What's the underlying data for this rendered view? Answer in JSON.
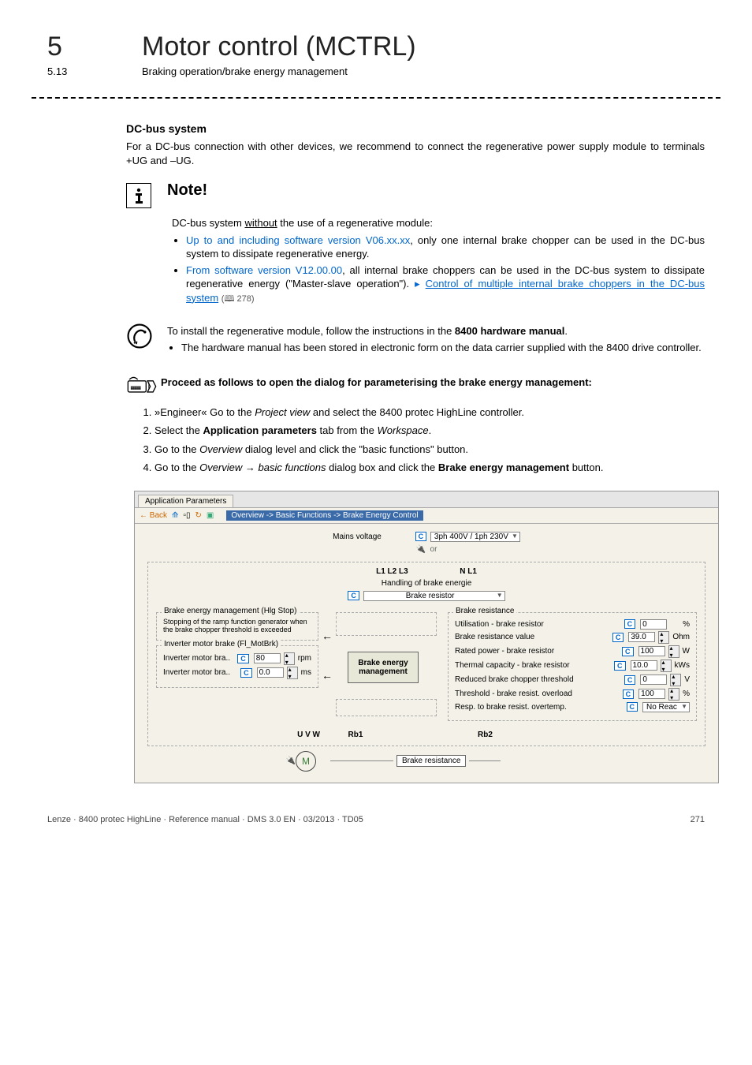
{
  "header": {
    "chapter_num": "5",
    "chapter_title": "Motor control (MCTRL)",
    "section_num": "5.13",
    "section_title": "Braking operation/brake energy management"
  },
  "dcbus": {
    "heading": "DC-bus system",
    "para": "For a DC-bus connection with other devices, we recommend to connect the regenerative power supply module to terminals +UG and –UG."
  },
  "note": {
    "title": "Note!",
    "intro_a": "DC-bus system ",
    "intro_underline": "without",
    "intro_b": " the use of a regenerative module:",
    "b1_blue": "Up to and including software version V06.xx.xx",
    "b1_rest": ", only one internal brake chopper can be used in the DC-bus system to dissipate regenerative energy.",
    "b2_blue": "From software version V12.00.00",
    "b2_rest_a": ", all internal brake choppers can be used in the DC-bus system to dissipate regenerative energy (\"Master-slave operation\").  ",
    "b2_link": "Control of multiple internal brake choppers in the DC-bus system",
    "b2_page": " 278)"
  },
  "tip": {
    "line1_a": "To install the regenerative module, follow the instructions in the ",
    "line1_b": "8400 hardware manual",
    "line1_c": ".",
    "bullet": "The hardware manual has been stored in electronic form on the data carrier supplied with the 8400 drive controller."
  },
  "proc": {
    "heading": "Proceed as follows to open the dialog for parameterising the brake energy management:",
    "s1_a": "»Engineer« Go to the ",
    "s1_i": "Project view",
    "s1_b": " and select the 8400 protec HighLine controller.",
    "s2_a": "Select the ",
    "s2_b": "Application parameters",
    "s2_c": " tab from the ",
    "s2_i": "Workspace",
    "s2_d": ".",
    "s3_a": "Go to the ",
    "s3_i": "Overview",
    "s3_b": " dialog level and click the \"basic functions\" button.",
    "s4_a": "Go to the ",
    "s4_i1": "Overview",
    "s4_arr": " → ",
    "s4_i2": "basic functions",
    "s4_b": " dialog box and click the ",
    "s4_bold": "Brake energy management",
    "s4_c": " button."
  },
  "ui": {
    "tab": "Application Parameters",
    "back": "← Back",
    "breadcrumb": "Overview -> Basic Functions -> Brake Energy Control",
    "mains_label": "Mains voltage",
    "mains_value": "3ph 400V / 1ph 230V",
    "or": "or",
    "l_labels": "L1  L2  L3",
    "n_label": "N  L1",
    "handling": "Handling of brake energie",
    "handling_value": "Brake resistor",
    "center": "Brake energy management",
    "grp1_title": "Brake energy management (Hlg Stop)",
    "grp1_desc": "Stopping of the ramp function generator when the brake chopper threshold is exceeded",
    "grp2_title": "Inverter motor brake (Fl_MotBrk)",
    "grp2_r1": "Inverter motor bra..",
    "grp2_r1_val": "80",
    "grp2_r1_unit": "rpm",
    "grp2_r2": "Inverter motor bra..",
    "grp2_r2_val": "0.0",
    "grp2_r2_unit": "ms",
    "res_title": "Brake resistance",
    "p1": "Utilisation - brake resistor",
    "p1v": "0",
    "p1u": "%",
    "p2": "Brake resistance value",
    "p2v": "39.0",
    "p2u": "Ohm",
    "p3": "Rated power - brake resistor",
    "p3v": "100",
    "p3u": "W",
    "p4": "Thermal capacity - brake resistor",
    "p4v": "10.0",
    "p4u": "kWs",
    "p5": "Reduced brake chopper threshold",
    "p5v": "0",
    "p5u": "V",
    "p6": "Threshold - brake resist. overload",
    "p6v": "100",
    "p6u": "%",
    "p7": "Resp. to brake resist. overtemp.",
    "p7v": "No Reac",
    "uvw": "U V W",
    "rb1": "Rb1",
    "rb2": "Rb2",
    "brake_res_box": "Brake resistance",
    "motor": "M"
  },
  "footer": {
    "left": "Lenze · 8400 protec HighLine · Reference manual · DMS 3.0 EN · 03/2013 · TD05",
    "right": "271"
  }
}
